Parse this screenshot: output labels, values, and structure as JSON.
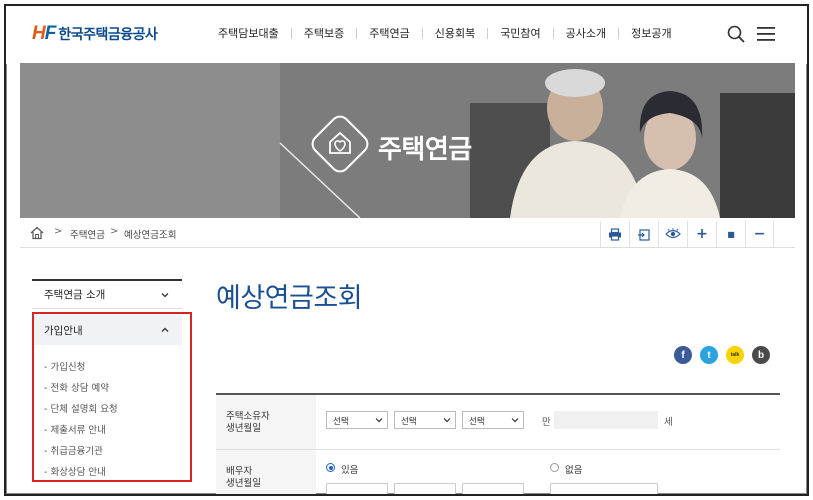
{
  "header": {
    "logo_mark_h": "H",
    "logo_mark_f": "F",
    "logo_text": "한국주택금융공사",
    "nav": [
      "주택담보대출",
      "주택보증",
      "주택연금",
      "신용회복",
      "국민참여",
      "공사소개",
      "정보공개"
    ]
  },
  "hero": {
    "title": "주택연금"
  },
  "breadcrumb": {
    "items": [
      "주택연금",
      "예상연금조회"
    ]
  },
  "tools": [
    "print",
    "export",
    "view",
    "+",
    "■",
    "−"
  ],
  "lnb": {
    "top_item": "주택연금 소개",
    "active_item": "가입안내",
    "sub_items": [
      "가입신청",
      "전화 상담 예약",
      "단체 설명회 요청",
      "제출서류 안내",
      "취급금융기관",
      "화상상담 안내"
    ]
  },
  "page": {
    "title": "예상연금조회"
  },
  "share": {
    "facebook": "f",
    "twitter": "t",
    "kakao": "talk",
    "band": "b"
  },
  "form": {
    "row1_label_a": "주택소유자",
    "row1_label_b": "생년월일",
    "select_label": "선택",
    "unit_man": "만",
    "unit_se": "세",
    "row2_label_a": "배우자",
    "row2_label_b": "생년월일",
    "radio_yes": "있음",
    "radio_no": "없음"
  },
  "colors": {
    "brand_blue": "#1b4f93",
    "brand_orange": "#e35a16",
    "highlight": "#d6261f"
  }
}
